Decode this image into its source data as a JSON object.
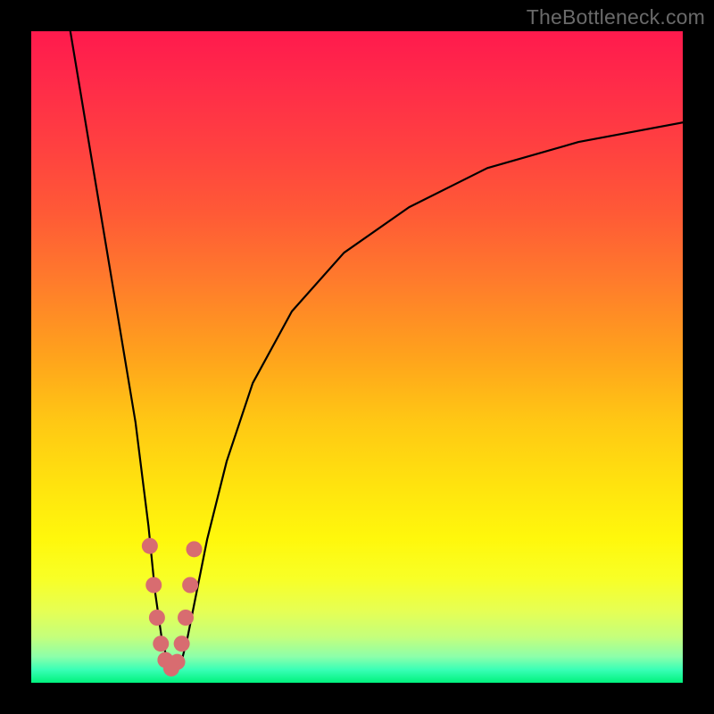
{
  "watermark": "TheBottleneck.com",
  "chart_data": {
    "type": "line",
    "title": "",
    "xlabel": "",
    "ylabel": "",
    "xlim": [
      0,
      100
    ],
    "ylim": [
      0,
      100
    ],
    "grid": false,
    "legend": false,
    "series": [
      {
        "name": "bottleneck-curve",
        "x": [
          6,
          8,
          10,
          12,
          14,
          16,
          18,
          19,
          20,
          21,
          22,
          23,
          24,
          25,
          27,
          30,
          34,
          40,
          48,
          58,
          70,
          84,
          100
        ],
        "y": [
          100,
          88,
          76,
          64,
          52,
          40,
          24,
          14,
          7,
          3,
          2,
          3,
          7,
          12,
          22,
          34,
          46,
          57,
          66,
          73,
          79,
          83,
          86
        ]
      }
    ],
    "markers": {
      "name": "highlight-beads",
      "color": "#d86c70",
      "points": [
        {
          "x": 18.2,
          "y": 21.0
        },
        {
          "x": 18.8,
          "y": 15.0
        },
        {
          "x": 19.3,
          "y": 10.0
        },
        {
          "x": 19.9,
          "y": 6.0
        },
        {
          "x": 20.6,
          "y": 3.5
        },
        {
          "x": 21.5,
          "y": 2.2
        },
        {
          "x": 22.4,
          "y": 3.2
        },
        {
          "x": 23.1,
          "y": 6.0
        },
        {
          "x": 23.7,
          "y": 10.0
        },
        {
          "x": 24.4,
          "y": 15.0
        },
        {
          "x": 25.0,
          "y": 20.5
        }
      ]
    }
  }
}
